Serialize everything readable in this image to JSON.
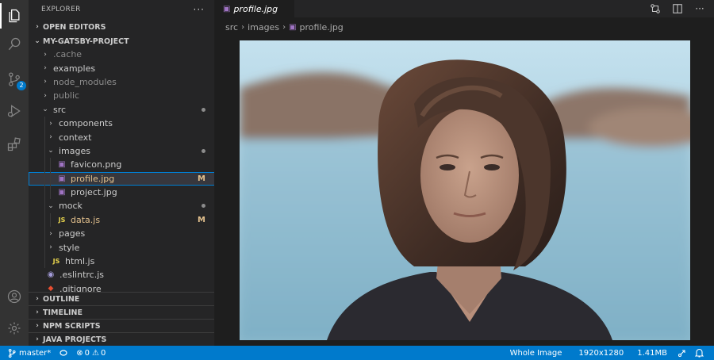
{
  "explorer": {
    "title": "EXPLORER",
    "more": "···",
    "open_editors": "OPEN EDITORS",
    "project": "MY-GATSBY-PROJECT",
    "tree": [
      {
        "label": ".cache",
        "kind": "folder",
        "open": false,
        "depth": 1,
        "dim": true
      },
      {
        "label": "examples",
        "kind": "folder",
        "open": false,
        "depth": 1
      },
      {
        "label": "node_modules",
        "kind": "folder",
        "open": false,
        "depth": 1,
        "dim": true
      },
      {
        "label": "public",
        "kind": "folder",
        "open": false,
        "depth": 1,
        "dim": true
      },
      {
        "label": "src",
        "kind": "folder",
        "open": true,
        "depth": 1,
        "dot": true
      },
      {
        "label": "components",
        "kind": "folder",
        "open": false,
        "depth": 2
      },
      {
        "label": "context",
        "kind": "folder",
        "open": false,
        "depth": 2
      },
      {
        "label": "images",
        "kind": "folder",
        "open": true,
        "depth": 2,
        "dot": true
      },
      {
        "label": "favicon.png",
        "kind": "image",
        "depth": 3
      },
      {
        "label": "profile.jpg",
        "kind": "image",
        "depth": 3,
        "selected": true,
        "status": "M"
      },
      {
        "label": "project.jpg",
        "kind": "image",
        "depth": 3
      },
      {
        "label": "mock",
        "kind": "folder",
        "open": true,
        "depth": 2,
        "dot": true
      },
      {
        "label": "data.js",
        "kind": "js",
        "depth": 3,
        "status": "M"
      },
      {
        "label": "pages",
        "kind": "folder",
        "open": false,
        "depth": 2
      },
      {
        "label": "style",
        "kind": "folder",
        "open": false,
        "depth": 2
      },
      {
        "label": "html.js",
        "kind": "js",
        "depth": 2
      },
      {
        "label": ".eslintrc.js",
        "kind": "eslint",
        "depth": 1
      },
      {
        "label": ".gitignore",
        "kind": "git",
        "depth": 1
      }
    ],
    "sections": [
      "OUTLINE",
      "TIMELINE",
      "NPM SCRIPTS",
      "JAVA PROJECTS"
    ]
  },
  "activity": {
    "scm_badge": "2"
  },
  "editor": {
    "tab_label": "profile.jpg",
    "breadcrumb": [
      "src",
      "images",
      "profile.jpg"
    ]
  },
  "status": {
    "branch": "master*",
    "errors": "0",
    "warnings": "0",
    "zoom_mode": "Whole Image",
    "dimensions": "1920x1280",
    "size": "1.41MB"
  },
  "colors": {
    "accent": "#007acc",
    "modified": "#e2c08d",
    "sidebar_bg": "#252526",
    "editor_bg": "#1e1e1e"
  }
}
